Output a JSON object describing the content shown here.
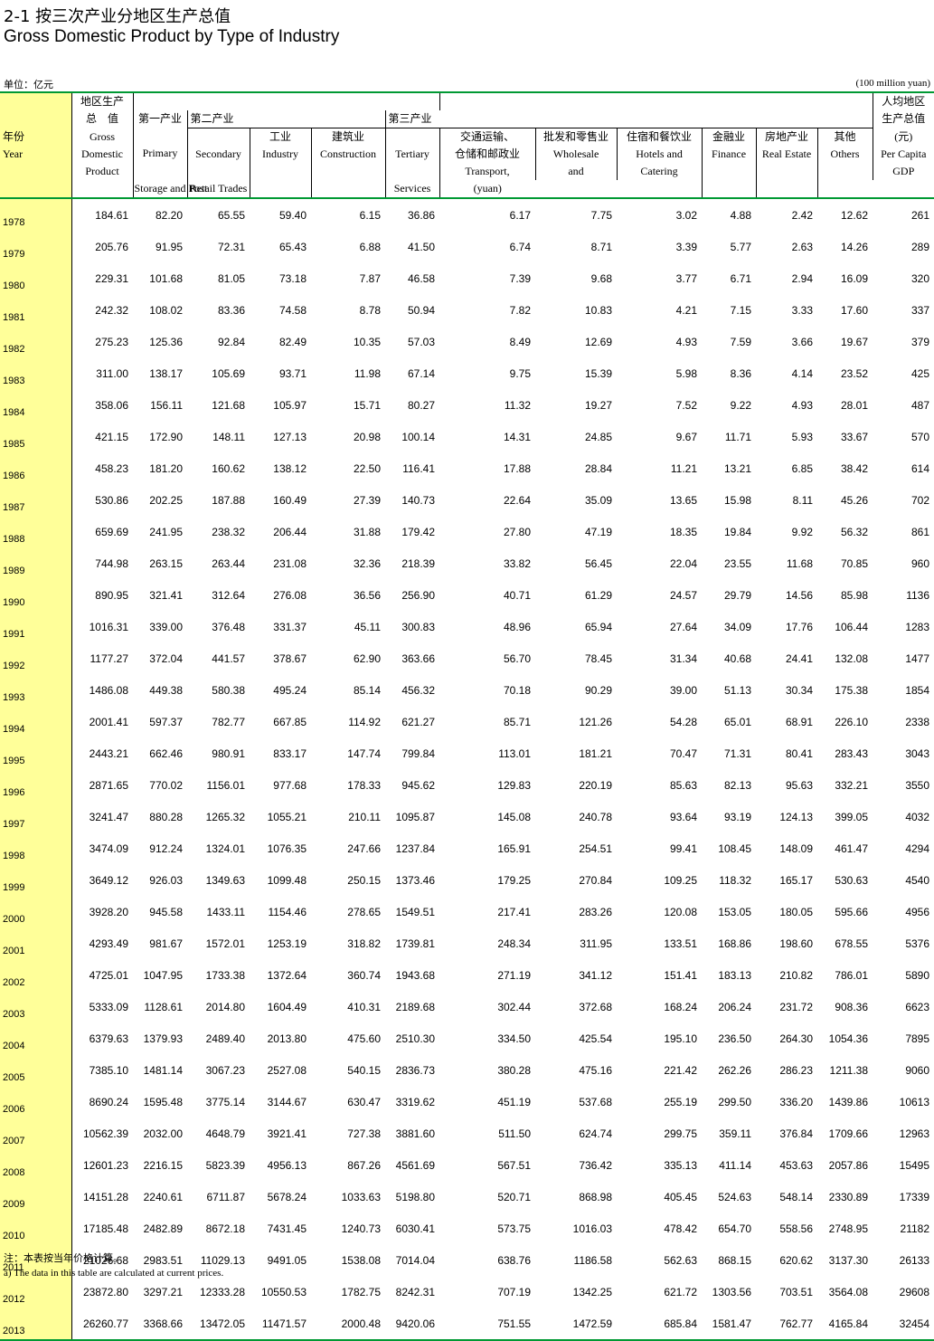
{
  "title_cn": "2-1  按三次产业分地区生产总值",
  "title_en": "Gross Domestic Product by Type of Industry",
  "unit_cn": "单位：亿元",
  "unit_en": "(100 million yuan)",
  "headers": {
    "year_cn": "年份",
    "year_en": "Year",
    "gdp_cn1": "地区生产",
    "gdp_cn2": "总　值",
    "gdp_en1": "Gross",
    "gdp_en2": "Domestic",
    "gdp_en3": "Product",
    "primary_cn": "第一产业",
    "primary_en": "Primary",
    "secondary_cn": "第二产业",
    "secondary_en": "Secondary",
    "industry_cn": "工业",
    "industry_en": "Industry",
    "construction_cn": "建筑业",
    "construction_en": "Construction",
    "tertiary_cn": "第三产业",
    "tertiary_en": "Tertiary",
    "transport_cn1": "交通运输、",
    "transport_cn2": "仓储和邮政业",
    "transport_en1": "Transport,",
    "transport_en2": "Storage and Post",
    "wholesale_cn": "批发和零售业",
    "wholesale_en1": "Wholesale",
    "wholesale_en2": "and",
    "wholesale_en3": "Retail Trades",
    "hotels_cn": "住宿和餐饮业",
    "hotels_en1": "Hotels and",
    "hotels_en2": "Catering",
    "hotels_en3": "Services",
    "finance_cn": "金融业",
    "finance_en": "Finance",
    "realestate_cn": "房地产业",
    "realestate_en": "Real Estate",
    "others_cn": "其他",
    "others_en": "Others",
    "percap_cn1": "人均地区",
    "percap_cn2": "生产总值",
    "percap_cn3": "(元)",
    "percap_en1": "Per Capita",
    "percap_en2": "GDP",
    "percap_en3": "(yuan)"
  },
  "rows": [
    [
      "1978",
      "184.61",
      "82.20",
      "65.55",
      "59.40",
      "6.15",
      "36.86",
      "6.17",
      "7.75",
      "3.02",
      "4.88",
      "2.42",
      "12.62",
      "261"
    ],
    [
      "1979",
      "205.76",
      "91.95",
      "72.31",
      "65.43",
      "6.88",
      "41.50",
      "6.74",
      "8.71",
      "3.39",
      "5.77",
      "2.63",
      "14.26",
      "289"
    ],
    [
      "1980",
      "229.31",
      "101.68",
      "81.05",
      "73.18",
      "7.87",
      "46.58",
      "7.39",
      "9.68",
      "3.77",
      "6.71",
      "2.94",
      "16.09",
      "320"
    ],
    [
      "1981",
      "242.32",
      "108.02",
      "83.36",
      "74.58",
      "8.78",
      "50.94",
      "7.82",
      "10.83",
      "4.21",
      "7.15",
      "3.33",
      "17.60",
      "337"
    ],
    [
      "1982",
      "275.23",
      "125.36",
      "92.84",
      "82.49",
      "10.35",
      "57.03",
      "8.49",
      "12.69",
      "4.93",
      "7.59",
      "3.66",
      "19.67",
      "379"
    ],
    [
      "1983",
      "311.00",
      "138.17",
      "105.69",
      "93.71",
      "11.98",
      "67.14",
      "9.75",
      "15.39",
      "5.98",
      "8.36",
      "4.14",
      "23.52",
      "425"
    ],
    [
      "1984",
      "358.06",
      "156.11",
      "121.68",
      "105.97",
      "15.71",
      "80.27",
      "11.32",
      "19.27",
      "7.52",
      "9.22",
      "4.93",
      "28.01",
      "487"
    ],
    [
      "1985",
      "421.15",
      "172.90",
      "148.11",
      "127.13",
      "20.98",
      "100.14",
      "14.31",
      "24.85",
      "9.67",
      "11.71",
      "5.93",
      "33.67",
      "570"
    ],
    [
      "1986",
      "458.23",
      "181.20",
      "160.62",
      "138.12",
      "22.50",
      "116.41",
      "17.88",
      "28.84",
      "11.21",
      "13.21",
      "6.85",
      "38.42",
      "614"
    ],
    [
      "1987",
      "530.86",
      "202.25",
      "187.88",
      "160.49",
      "27.39",
      "140.73",
      "22.64",
      "35.09",
      "13.65",
      "15.98",
      "8.11",
      "45.26",
      "702"
    ],
    [
      "1988",
      "659.69",
      "241.95",
      "238.32",
      "206.44",
      "31.88",
      "179.42",
      "27.80",
      "47.19",
      "18.35",
      "19.84",
      "9.92",
      "56.32",
      "861"
    ],
    [
      "1989",
      "744.98",
      "263.15",
      "263.44",
      "231.08",
      "32.36",
      "218.39",
      "33.82",
      "56.45",
      "22.04",
      "23.55",
      "11.68",
      "70.85",
      "960"
    ],
    [
      "1990",
      "890.95",
      "321.41",
      "312.64",
      "276.08",
      "36.56",
      "256.90",
      "40.71",
      "61.29",
      "24.57",
      "29.79",
      "14.56",
      "85.98",
      "1136"
    ],
    [
      "1991",
      "1016.31",
      "339.00",
      "376.48",
      "331.37",
      "45.11",
      "300.83",
      "48.96",
      "65.94",
      "27.64",
      "34.09",
      "17.76",
      "106.44",
      "1283"
    ],
    [
      "1992",
      "1177.27",
      "372.04",
      "441.57",
      "378.67",
      "62.90",
      "363.66",
      "56.70",
      "78.45",
      "31.34",
      "40.68",
      "24.41",
      "132.08",
      "1477"
    ],
    [
      "1993",
      "1486.08",
      "449.38",
      "580.38",
      "495.24",
      "85.14",
      "456.32",
      "70.18",
      "90.29",
      "39.00",
      "51.13",
      "30.34",
      "175.38",
      "1854"
    ],
    [
      "1994",
      "2001.41",
      "597.37",
      "782.77",
      "667.85",
      "114.92",
      "621.27",
      "85.71",
      "121.26",
      "54.28",
      "65.01",
      "68.91",
      "226.10",
      "2338"
    ],
    [
      "1995",
      "2443.21",
      "662.46",
      "980.91",
      "833.17",
      "147.74",
      "799.84",
      "113.01",
      "181.21",
      "70.47",
      "71.31",
      "80.41",
      "283.43",
      "3043"
    ],
    [
      "1996",
      "2871.65",
      "770.02",
      "1156.01",
      "977.68",
      "178.33",
      "945.62",
      "129.83",
      "220.19",
      "85.63",
      "82.13",
      "95.63",
      "332.21",
      "3550"
    ],
    [
      "1997",
      "3241.47",
      "880.28",
      "1265.32",
      "1055.21",
      "210.11",
      "1095.87",
      "145.08",
      "240.78",
      "93.64",
      "93.19",
      "124.13",
      "399.05",
      "4032"
    ],
    [
      "1998",
      "3474.09",
      "912.24",
      "1324.01",
      "1076.35",
      "247.66",
      "1237.84",
      "165.91",
      "254.51",
      "99.41",
      "108.45",
      "148.09",
      "461.47",
      "4294"
    ],
    [
      "1999",
      "3649.12",
      "926.03",
      "1349.63",
      "1099.48",
      "250.15",
      "1373.46",
      "179.25",
      "270.84",
      "109.25",
      "118.32",
      "165.17",
      "530.63",
      "4540"
    ],
    [
      "2000",
      "3928.20",
      "945.58",
      "1433.11",
      "1154.46",
      "278.65",
      "1549.51",
      "217.41",
      "283.26",
      "120.08",
      "153.05",
      "180.05",
      "595.66",
      "4956"
    ],
    [
      "2001",
      "4293.49",
      "981.67",
      "1572.01",
      "1253.19",
      "318.82",
      "1739.81",
      "248.34",
      "311.95",
      "133.51",
      "168.86",
      "198.60",
      "678.55",
      "5376"
    ],
    [
      "2002",
      "4725.01",
      "1047.95",
      "1733.38",
      "1372.64",
      "360.74",
      "1943.68",
      "271.19",
      "341.12",
      "151.41",
      "183.13",
      "210.82",
      "786.01",
      "5890"
    ],
    [
      "2003",
      "5333.09",
      "1128.61",
      "2014.80",
      "1604.49",
      "410.31",
      "2189.68",
      "302.44",
      "372.68",
      "168.24",
      "206.24",
      "231.72",
      "908.36",
      "6623"
    ],
    [
      "2004",
      "6379.63",
      "1379.93",
      "2489.40",
      "2013.80",
      "475.60",
      "2510.30",
      "334.50",
      "425.54",
      "195.10",
      "236.50",
      "264.30",
      "1054.36",
      "7895"
    ],
    [
      "2005",
      "7385.10",
      "1481.14",
      "3067.23",
      "2527.08",
      "540.15",
      "2836.73",
      "380.28",
      "475.16",
      "221.42",
      "262.26",
      "286.23",
      "1211.38",
      "9060"
    ],
    [
      "2006",
      "8690.24",
      "1595.48",
      "3775.14",
      "3144.67",
      "630.47",
      "3319.62",
      "451.19",
      "537.68",
      "255.19",
      "299.50",
      "336.20",
      "1439.86",
      "10613"
    ],
    [
      "2007",
      "10562.39",
      "2032.00",
      "4648.79",
      "3921.41",
      "727.38",
      "3881.60",
      "511.50",
      "624.74",
      "299.75",
      "359.11",
      "376.84",
      "1709.66",
      "12963"
    ],
    [
      "2008",
      "12601.23",
      "2216.15",
      "5823.39",
      "4956.13",
      "867.26",
      "4561.69",
      "567.51",
      "736.42",
      "335.13",
      "411.14",
      "453.63",
      "2057.86",
      "15495"
    ],
    [
      "2009",
      "14151.28",
      "2240.61",
      "6711.87",
      "5678.24",
      "1033.63",
      "5198.80",
      "520.71",
      "868.98",
      "405.45",
      "524.63",
      "548.14",
      "2330.89",
      "17339"
    ],
    [
      "2010",
      "17185.48",
      "2482.89",
      "8672.18",
      "7431.45",
      "1240.73",
      "6030.41",
      "573.75",
      "1016.03",
      "478.42",
      "654.70",
      "558.56",
      "2748.95",
      "21182"
    ],
    [
      "2011",
      "21026.68",
      "2983.51",
      "11029.13",
      "9491.05",
      "1538.08",
      "7014.04",
      "638.76",
      "1186.58",
      "562.63",
      "868.15",
      "620.62",
      "3137.30",
      "26133"
    ],
    [
      "2012",
      "23872.80",
      "3297.21",
      "12333.28",
      "10550.53",
      "1782.75",
      "8242.31",
      "707.19",
      "1342.25",
      "621.72",
      "1303.56",
      "703.51",
      "3564.08",
      "29608"
    ],
    [
      "2013",
      "26260.77",
      "3368.66",
      "13472.05",
      "11471.57",
      "2000.48",
      "9420.06",
      "751.55",
      "1472.59",
      "685.84",
      "1581.47",
      "762.77",
      "4165.84",
      "32454"
    ]
  ],
  "note_cn": "注：本表按当年价格计算。",
  "note_en": "a) The data in this table are calculated at current prices."
}
